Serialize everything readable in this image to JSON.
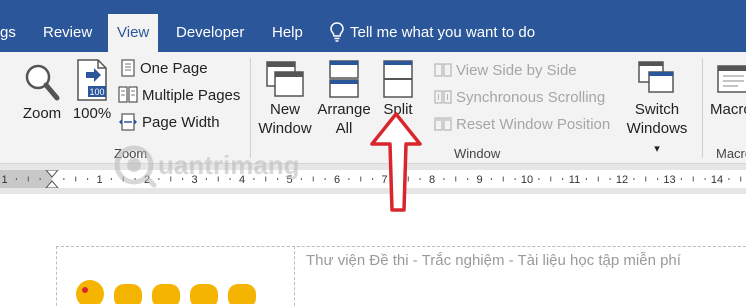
{
  "tabs": {
    "partial": "gs",
    "review": "Review",
    "view": "View",
    "developer": "Developer",
    "help": "Help",
    "tellme": "Tell me what you want to do"
  },
  "zoom_group": {
    "zoom": "Zoom",
    "hundred": "100%",
    "hundred_badge": "100",
    "one_page": "One Page",
    "multiple_pages": "Multiple Pages",
    "page_width": "Page Width",
    "label": "Zoom"
  },
  "window_group": {
    "new_window_1": "New",
    "new_window_2": "Window",
    "arrange_all_1": "Arrange",
    "arrange_all_2": "All",
    "split": "Split",
    "view_side_by_side": "View Side by Side",
    "synchronous_scrolling": "Synchronous Scrolling",
    "reset_window_position": "Reset Window Position",
    "switch_windows_1": "Switch",
    "switch_windows_2": "Windows",
    "switch_windows_caret": "▾",
    "label": "Window"
  },
  "macros_group": {
    "macros": "Macro",
    "label": "Macro"
  },
  "ruler": {
    "numbers": [
      "1",
      "1",
      "2",
      "3",
      "4",
      "5",
      "6",
      "7",
      "8",
      "9",
      "10",
      "11",
      "12",
      "13",
      "14"
    ]
  },
  "document": {
    "text": "Thư viện Đề thi - Trắc nghiệm - Tài liệu học tập miễn phí"
  },
  "watermark": {
    "text": "uantrimang"
  },
  "colors": {
    "tab_bar": "#2b579a",
    "ribbon": "#f3f3f3",
    "annotation_arrow": "#d9262c"
  }
}
